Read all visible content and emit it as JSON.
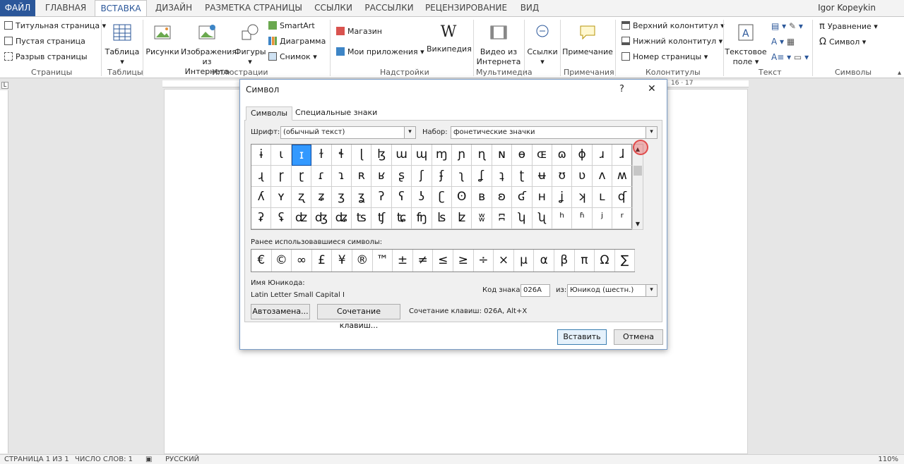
{
  "tabs": [
    "ФАЙЛ",
    "ГЛАВНАЯ",
    "ВСТАВКА",
    "ДИЗАЙН",
    "РАЗМЕТКА СТРАНИЦЫ",
    "ССЫЛКИ",
    "РАССЫЛКИ",
    "РЕЦЕНЗИРОВАНИЕ",
    "ВИД"
  ],
  "user": "Igor Kopeykin",
  "ribbon": {
    "pages": {
      "title_page": "Титульная страница",
      "blank_page": "Пустая страница",
      "page_break": "Разрыв страницы",
      "group": "Страницы"
    },
    "tables": {
      "table": "Таблица",
      "group": "Таблицы"
    },
    "illustrations": {
      "pictures": "Рисунки",
      "online_pictures_1": "Изображения",
      "online_pictures_2": "из Интернета",
      "shapes": "Фигуры",
      "smartart": "SmartArt",
      "chart": "Диаграмма",
      "screenshot": "Снимок",
      "group": "Иллюстрации"
    },
    "addins": {
      "store": "Магазин",
      "my_apps": "Мои приложения",
      "wikipedia": "Википедия",
      "group": "Надстройки"
    },
    "media": {
      "video_1": "Видео из",
      "video_2": "Интернета",
      "group": "Мультимедиа"
    },
    "links": {
      "links": "Ссылки",
      "group": ""
    },
    "comments": {
      "comment": "Примечание",
      "group": "Примечания"
    },
    "header_footer": {
      "header": "Верхний колонтитул",
      "footer": "Нижний колонтитул",
      "page_number": "Номер страницы",
      "group": "Колонтитулы"
    },
    "text": {
      "textbox_1": "Текстовое",
      "textbox_2": "поле",
      "group": "Текст"
    },
    "symbols": {
      "equation": "Уравнение",
      "symbol": "Символ",
      "group": "Символы"
    }
  },
  "ruler": {
    "marks": "16 · 17"
  },
  "dialog": {
    "title": "Символ",
    "help": "?",
    "close": "✕",
    "tab_symbols": "Символы",
    "tab_special": "Специальные знаки",
    "font_label": "Шрифт:",
    "font_value": "(обычный текст)",
    "subset_label": "Набор:",
    "subset_value": "фонетические значки",
    "symbols": [
      [
        "ɨ",
        "ɩ",
        "ɪ",
        "ɫ",
        "ɬ",
        "ɭ",
        "ɮ",
        "ɯ",
        "ɰ",
        "ɱ",
        "ɲ",
        "ɳ",
        "ɴ",
        "ɵ",
        "ɶ",
        "ɷ",
        "ɸ",
        "ɹ",
        "ɺ"
      ],
      [
        "ɻ",
        "ɼ",
        "ɽ",
        "ɾ",
        "ɿ",
        "ʀ",
        "ʁ",
        "ʂ",
        "ʃ",
        "ʄ",
        "ʅ",
        "ʆ",
        "ʇ",
        "ʈ",
        "ʉ",
        "ʊ",
        "ʋ",
        "ʌ",
        "ʍ"
      ],
      [
        "ʎ",
        "ʏ",
        "ʐ",
        "ʑ",
        "ʒ",
        "ʓ",
        "ʔ",
        "ʕ",
        "ʖ",
        "ʗ",
        "ʘ",
        "ʙ",
        "ʚ",
        "ʛ",
        "ʜ",
        "ʝ",
        "ʞ",
        "ʟ",
        "ʠ"
      ],
      [
        "ʡ",
        "ʢ",
        "ʣ",
        "ʤ",
        "ʥ",
        "ʦ",
        "ʧ",
        "ʨ",
        "ʩ",
        "ʪ",
        "ʫ",
        "ʬ",
        "ʭ",
        "ʮ",
        "ʯ",
        "ʰ",
        "ʱ",
        "ʲ",
        "ʳ"
      ]
    ],
    "selected": [
      0,
      2
    ],
    "recent_label": "Ранее использовавшиеся символы:",
    "recent": [
      "€",
      "©",
      "∞",
      "£",
      "¥",
      "®",
      "™",
      "±",
      "≠",
      "≤",
      "≥",
      "÷",
      "×",
      "μ",
      "α",
      "β",
      "π",
      "Ω",
      "∑"
    ],
    "unicode_name_label": "Имя Юникода:",
    "unicode_name": "Latin Letter Small Capital I",
    "code_label": "Код знака:",
    "code_value": "026A",
    "from_label": "из:",
    "from_value": "Юникод (шестн.)",
    "autocorrect": "Автозамена...",
    "shortcut_key": "Сочетание клавиш...",
    "shortcut_text": "Сочетание клавиш: 026A, Alt+X",
    "insert": "Вставить",
    "cancel": "Отмена"
  },
  "status": {
    "page": "СТРАНИЦА 1 ИЗ 1",
    "words": "ЧИСЛО СЛОВ: 1",
    "lang": "РУССКИЙ",
    "zoom": "110%"
  }
}
